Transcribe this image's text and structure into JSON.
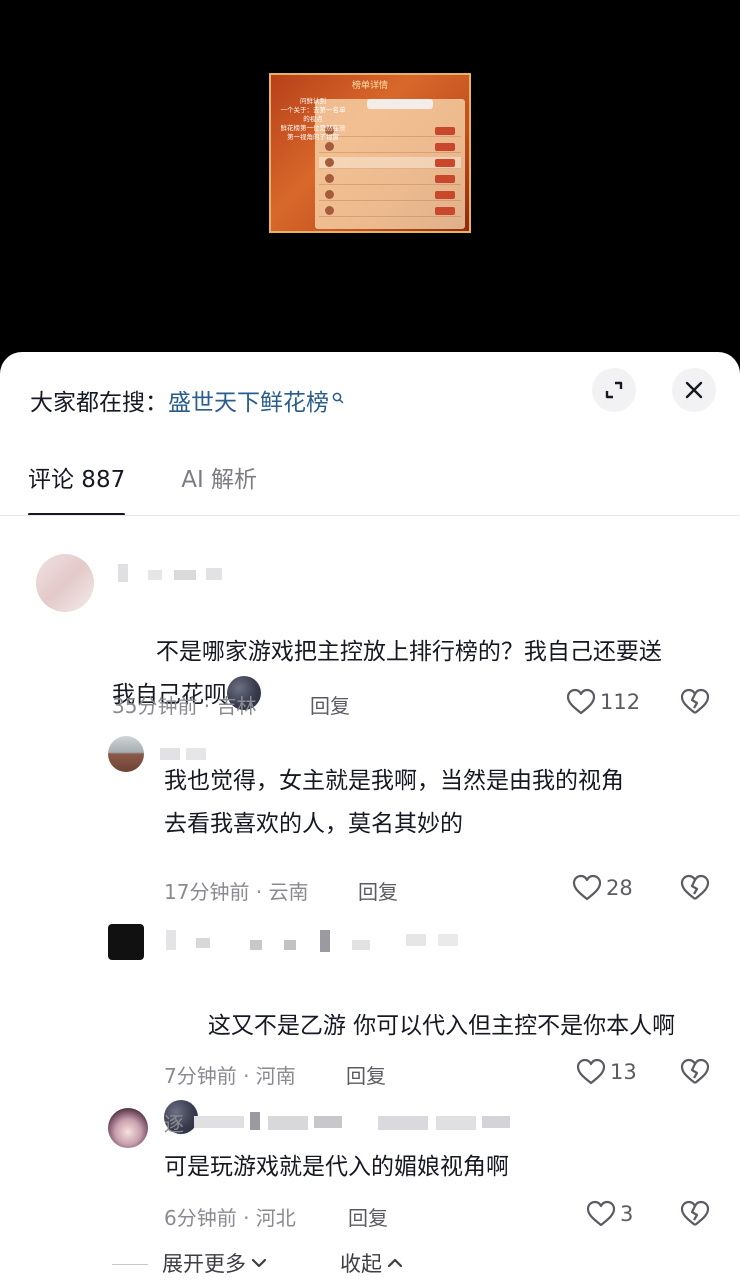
{
  "video": {
    "thumbnail_title": "榜单详情",
    "thumbnail_note": "问鲜认到\n一个关于：去第一名单\n的视点\n鲜花榜第一位是然在没\n第一视角的子视窗"
  },
  "search_bar": {
    "prefix": "大家都在搜：",
    "term": "盛世天下鲜花榜"
  },
  "tabs": [
    {
      "label": "评论 887"
    },
    {
      "label": "AI 解析"
    }
  ],
  "comments": [
    {
      "text": "不是哪家游戏把主控放上排行榜的？我自己还要送\n我自己花呗",
      "time_location": "35分钟前 · 吉林",
      "reply": "回复",
      "likes": "112"
    },
    {
      "text": "我也觉得，女主就是我啊，当然是由我的视角\n去看我喜欢的人，莫名其妙的",
      "time_location": "17分钟前 · 云南",
      "reply": "回复",
      "likes": "28"
    },
    {
      "text": "这又不是乙游 你可以代入但主控不是你本人啊",
      "time_location": "7分钟前 · 河南",
      "reply": "回复",
      "likes": "13"
    },
    {
      "name_visible": "逐",
      "text": "可是玩游戏就是代入的媚娘视角啊",
      "time_location": "6分钟前 · 河北",
      "reply": "回复",
      "likes": "3"
    }
  ],
  "footer": {
    "expand_more": "展开更多",
    "collapse": "收起"
  },
  "colors": {
    "search_term": "#2a5d8d",
    "text_primary": "#161823",
    "text_secondary": "#8a8b91"
  }
}
